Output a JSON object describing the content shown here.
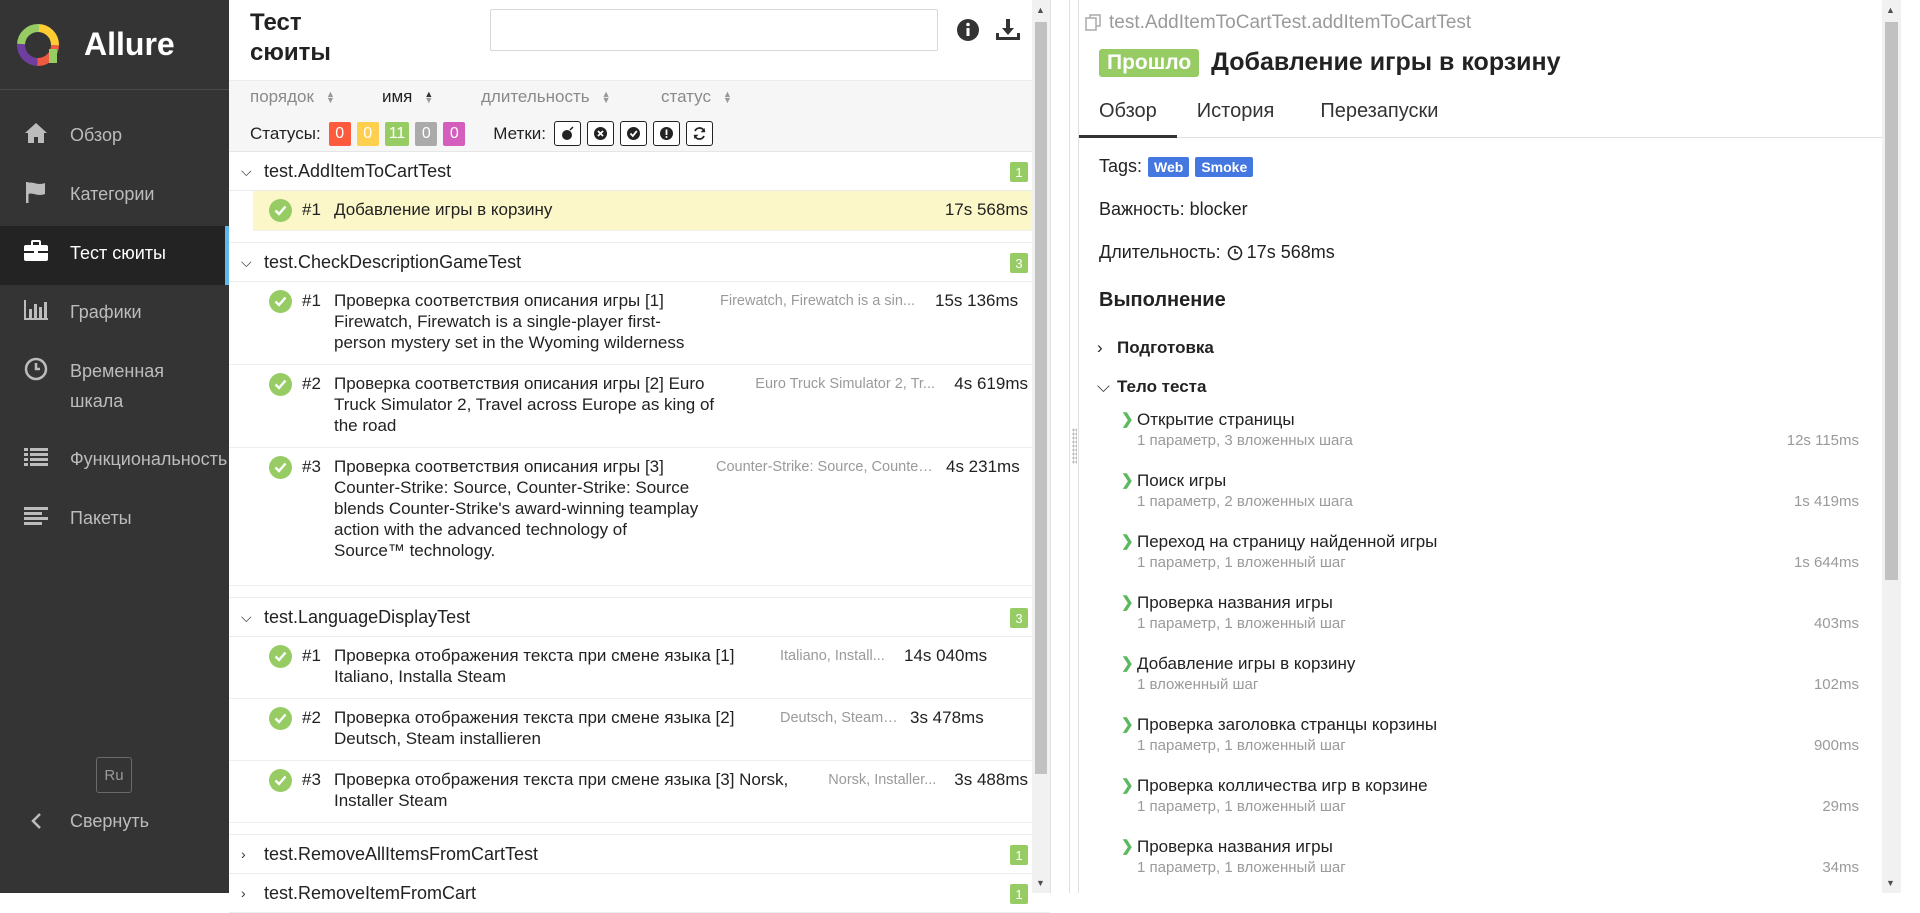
{
  "sidebar": {
    "brand": "Allure",
    "items": [
      {
        "label": "Обзор",
        "icon": "home-icon"
      },
      {
        "label": "Категории",
        "icon": "flag-icon"
      },
      {
        "label": "Тест сюиты",
        "icon": "briefcase-icon"
      },
      {
        "label": "Графики",
        "icon": "bar-chart-icon"
      },
      {
        "label": "Временная\nшкала",
        "icon": "clock-icon"
      },
      {
        "label": "Функциональность",
        "icon": "list-icon"
      },
      {
        "label": "Пакеты",
        "icon": "align-left-icon"
      }
    ],
    "language": "Ru",
    "collapse_label": "Свернуть"
  },
  "tree": {
    "title": "Тест\nсюиты",
    "search_placeholder": "",
    "sort": {
      "order": "порядок",
      "name": "имя",
      "duration": "длительность",
      "status": "статус"
    },
    "statuses_label": "Статусы:",
    "status_counts": [
      {
        "value": "0",
        "color": "#fd5a3e"
      },
      {
        "value": "0",
        "color": "#ffd050"
      },
      {
        "value": "11",
        "color": "#97cc64"
      },
      {
        "value": "0",
        "color": "#aaaaaa"
      },
      {
        "value": "0",
        "color": "#d35ebe"
      }
    ],
    "marks_label": "Метки:",
    "groups": [
      {
        "name": "test.AddItemToCartTest",
        "count": "1",
        "tests": [
          {
            "num": "#1",
            "name": "Добавление игры в корзину",
            "params": "",
            "duration": "17s 568ms"
          }
        ]
      },
      {
        "name": "test.CheckDescriptionGameTest",
        "count": "3",
        "tests": [
          {
            "num": "#1",
            "name": "Проверка соответствия описания игры [1] Firewatch, Firewatch is a single-player first-person mystery set in the Wyoming wilderness",
            "params": "Firewatch, Firewatch is a sin...",
            "duration": "15s 136ms"
          },
          {
            "num": "#2",
            "name": "Проверка соответствия описания игры [2] Euro Truck Simulator 2, Travel across Europe as king of the road",
            "params": "Euro Truck Simulator 2, Tr...",
            "duration": "4s 619ms"
          },
          {
            "num": "#3",
            "name": "Проверка соответствия описания игры [3] Counter-Strike: Source, Counter-Strike: Source blends Counter-Strike's award-winning teamplay action with the advanced technology of Source™ technology.",
            "params": "Counter-Strike: Source, Counter...",
            "duration": "4s 231ms"
          }
        ]
      },
      {
        "name": "test.LanguageDisplayTest",
        "count": "3",
        "tests": [
          {
            "num": "#1",
            "name": "Проверка отображения текста при смене языка [1] Italiano, Installa Steam",
            "params": "Italiano, Install...",
            "duration": "14s 040ms"
          },
          {
            "num": "#2",
            "name": "Проверка отображения текста при смене языка [2] Deutsch, Steam installieren",
            "params": "Deutsch, Steam i...",
            "duration": "3s 478ms"
          },
          {
            "num": "#3",
            "name": "Проверка отображения текста при смене языка [3] Norsk, Installer Steam",
            "params": "Norsk, Installer...",
            "duration": "3s 488ms"
          }
        ]
      },
      {
        "name": "test.RemoveAllItemsFromCartTest",
        "count": "1",
        "tests": []
      },
      {
        "name": "test.RemoveItemFromCart",
        "count": "1",
        "tests": []
      }
    ]
  },
  "detail": {
    "path": "test.AddItemToCartTest.addItemToCartTest",
    "status": "Прошло",
    "title": "Добавление игры в корзину",
    "tabs": [
      "Обзор",
      "История",
      "Перезапуски"
    ],
    "tags_label": "Tags:",
    "tags": [
      "Web",
      "Smoke"
    ],
    "severity": "Важность: blocker",
    "duration_label": "Длительность:",
    "duration": "17s 568ms",
    "execution_title": "Выполнение",
    "setup_label": "Подготовка",
    "body_label": "Тело теста",
    "steps": [
      {
        "name": "Открытие страницы",
        "sub": "1 параметр, 3 вложенных шага",
        "duration": "12s 115ms"
      },
      {
        "name": "Поиск игры",
        "sub": "1 параметр, 2 вложенных шага",
        "duration": "1s 419ms"
      },
      {
        "name": "Переход на страницу найденной игры",
        "sub": "1 параметр, 1 вложенный шаг",
        "duration": "1s 644ms"
      },
      {
        "name": "Проверка названия игры",
        "sub": "1 параметр, 1 вложенный шаг",
        "duration": "403ms"
      },
      {
        "name": "Добавление игры в корзину",
        "sub": "1 вложенный шаг",
        "duration": "102ms"
      },
      {
        "name": "Проверка заголовка странцы корзины",
        "sub": "1 параметр, 1 вложенный шаг",
        "duration": "900ms"
      },
      {
        "name": "Проверка колличества игр в корзине",
        "sub": "1 параметр, 1 вложенный шаг",
        "duration": "29ms"
      },
      {
        "name": "Проверка названия игры",
        "sub": "1 параметр, 1 вложенный шаг",
        "duration": "34ms"
      }
    ]
  }
}
